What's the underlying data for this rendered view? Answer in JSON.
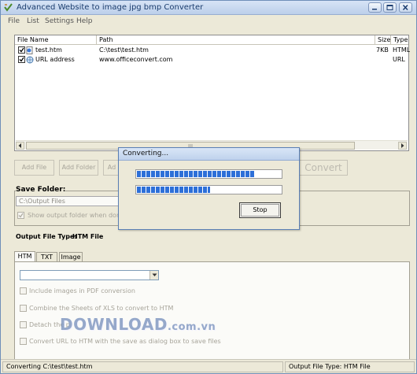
{
  "window": {
    "title": "Advanced Website to image jpg bmp Converter",
    "icon": "v-check-app-icon",
    "controls": [
      "minimize-icon",
      "maximize-icon",
      "close-icon"
    ]
  },
  "menu": [
    "File",
    "List",
    "Settings",
    "Help"
  ],
  "file_list": {
    "columns": {
      "file_name": "File Name",
      "path": "Path",
      "size": "Size",
      "type": "Type"
    },
    "rows": [
      {
        "checked": true,
        "icon": "html-file-icon",
        "file_name": "test.htm",
        "path": "C:\\test\\test.htm",
        "size": "7KB",
        "type": "HTML"
      },
      {
        "checked": true,
        "icon": "globe-icon",
        "file_name": "URL address",
        "path": "www.officeconvert.com",
        "size": "",
        "type": "URL"
      }
    ]
  },
  "buttons": {
    "add_file": "Add File",
    "add_folder": "Add Folder",
    "add_partial": "Ad",
    "convert": "Convert"
  },
  "save_folder": {
    "label": "Save Folder:",
    "value": "C:\\Output Files",
    "show_output_label": "Show output folder when done",
    "show_output_checked": true
  },
  "output_type": {
    "label": "Output File Type:",
    "value": "HTM File"
  },
  "tabs": [
    "HTM",
    "TXT",
    "Image"
  ],
  "active_tab": "HTM",
  "options": [
    "Include images in PDF conversion",
    "Combine the Sheets of XLS to convert to HTM",
    "Detach the p",
    "Convert URL to HTM with the save as dialog box to save files"
  ],
  "status": {
    "left": "Converting  C:\\test\\test.htm",
    "right": "Output File Type:   HTM File"
  },
  "dialog": {
    "title": "Converting...",
    "progress1": 0.82,
    "progress2": 0.51,
    "stop_label": "Stop"
  },
  "watermark": {
    "main": "DOWNLOAD",
    "suffix": ".com.vn"
  }
}
